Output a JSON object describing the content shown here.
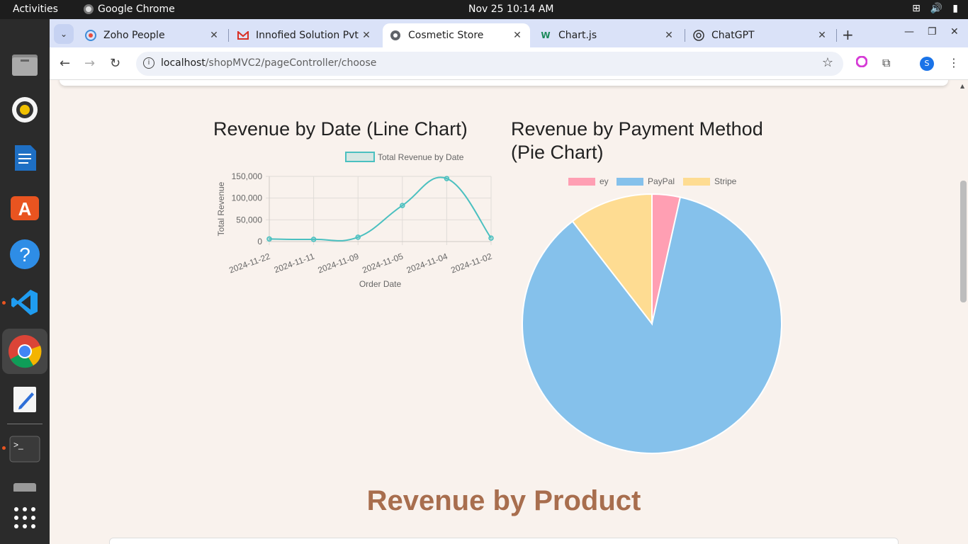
{
  "system_bar": {
    "activities": "Activities",
    "app_name": "Google Chrome",
    "datetime": "Nov 25  10:14 AM"
  },
  "browser": {
    "tabs": [
      {
        "label": "Zoho People",
        "icon": "zoho-icon"
      },
      {
        "label": "Innofied Solution Pvt",
        "icon": "gmail-icon"
      },
      {
        "label": "Cosmetic Store",
        "icon": "globe-icon",
        "active": true
      },
      {
        "label": "Chart.js",
        "icon": "chartjs-icon"
      },
      {
        "label": "ChatGPT",
        "icon": "chatgpt-icon"
      }
    ],
    "url_host": "localhost",
    "url_path": "/shopMVC2/pageController/choose",
    "profile_initial": "S"
  },
  "charts": {
    "line_title": "Revenue by Date (Line Chart)",
    "pie_title_line1": "Revenue by Payment Method",
    "pie_title_line2": "(Pie Chart)"
  },
  "section_title": "Revenue by Product",
  "chart_data": [
    {
      "type": "line",
      "title": "Revenue by Date (Line Chart)",
      "xlabel": "Order Date",
      "ylabel": "Total Revenue",
      "series": [
        {
          "name": "Total Revenue by Date",
          "values": [
            6000,
            5000,
            10000,
            83000,
            145000,
            8000
          ]
        }
      ],
      "categories": [
        "2024-11-22",
        "2024-11-11",
        "2024-11-09",
        "2024-11-05",
        "2024-11-04",
        "2024-11-02"
      ],
      "ylim": [
        0,
        150000
      ],
      "yticks": [
        "0",
        "50,000",
        "100,000",
        "150,000"
      ],
      "grid": true,
      "legend": "top",
      "color": "#4bc0c0"
    },
    {
      "type": "pie",
      "title": "Revenue by Payment Method (Pie Chart)",
      "labels": [
        "ey",
        "PayPal",
        "Stripe"
      ],
      "values": [
        3.5,
        86,
        10.5
      ],
      "colors": [
        "#ff9fb3",
        "#85c1eb",
        "#fedc92"
      ],
      "legend": "top"
    }
  ]
}
